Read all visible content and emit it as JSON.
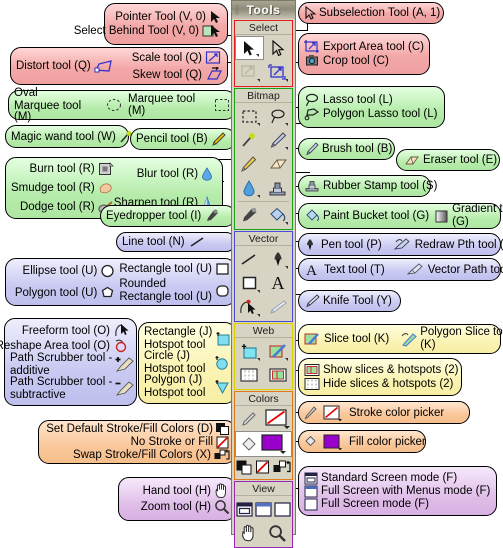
{
  "panel": {
    "title": "Tools",
    "groups": [
      {
        "name": "Select",
        "color": "#e21b1b",
        "tools": [
          "Pointer Tool (V, 0)",
          "Subselection Tool (A, 1)",
          "Export Area tool (C)",
          "Crop tool (C)"
        ]
      },
      {
        "name": "Bitmap",
        "color": "#16a316",
        "tools": [
          "Marquee tool (M)",
          "Lasso tool (L)",
          "Magic wand tool (W)",
          "Brush tool (B)",
          "Pencil tool (B)",
          "Eraser tool (E)",
          "Blur tool (R)",
          "Rubber Stamp tool (S)",
          "Eyedropper tool (I)",
          "Paint Bucket tool (G)"
        ]
      },
      {
        "name": "Vector",
        "color": "#4a4ad6",
        "tools": [
          "Line tool (N)",
          "Pen tool (P)",
          "Rectangle tool (U)",
          "Text tool (T)",
          "Freeform tool (O)",
          "Knife Tool (Y)"
        ]
      },
      {
        "name": "Web",
        "color": "#e0d000",
        "tools": [
          "Rectangle (J) Hotspot tool",
          "Slice tool (K)",
          "Hide slices & hotspots (2)",
          "Show slices & hotspots (2)"
        ]
      },
      {
        "name": "Colors",
        "color": "#e07a1b",
        "tools": [
          "Stroke color picker",
          "Fill color picker",
          "Set Default Stroke/Fill Colors (D)",
          "No Stroke or Fill",
          "Swap Stroke/Fill Colors (X)"
        ]
      },
      {
        "name": "View",
        "color": "#9b26b6",
        "tools": [
          "Standard Screen mode (F)",
          "Full Screen with Menus mode (F)",
          "Full Screen mode (F)",
          "Hand tool (H)",
          "Zoom tool (H)"
        ]
      }
    ]
  },
  "callouts": {
    "pointer": {
      "lines": [
        "Pointer Tool (V, 0)",
        "Select Behind Tool (V, 0)"
      ],
      "color": "pink"
    },
    "subselection": {
      "lines": [
        "Subselection Tool (A, 1)"
      ],
      "color": "pink"
    },
    "distort": {
      "lines": [
        "Distort tool (Q)"
      ],
      "color": "pink"
    },
    "scale_skew": {
      "lines": [
        "Scale tool (Q)",
        "Skew tool (Q)"
      ],
      "color": "pink"
    },
    "export_crop": {
      "lines": [
        "Export Area tool (C)",
        "Crop tool (C)"
      ],
      "color": "pink"
    },
    "marquee": {
      "lines": [
        "Oval\nMarquee tool (M)",
        "Marquee tool (M)"
      ],
      "color": "green",
      "oval": "Oval",
      "oval2": "Marquee tool (M)",
      "rect": "Marquee tool (M)"
    },
    "lasso": {
      "lines": [
        "Lasso tool (L)",
        "Polygon Lasso tool (L)"
      ],
      "color": "green"
    },
    "magicwand": {
      "lines": [
        "Magic wand tool (W)"
      ],
      "color": "green"
    },
    "pencil": {
      "lines": [
        "Pencil tool (B)"
      ],
      "color": "green"
    },
    "brush": {
      "lines": [
        "Brush tool (B)"
      ],
      "color": "green"
    },
    "eraser": {
      "lines": [
        "Eraser tool (E)"
      ],
      "color": "green"
    },
    "retouch": {
      "color": "green",
      "burn": "Burn tool (R)",
      "blur": "Blur tool (R)",
      "smudge": "Smudge tool (R)",
      "sharpen": "Sharpen tool (R)",
      "dodge": "Dodge tool (R)"
    },
    "rubberstamp": {
      "lines": [
        "Rubber Stamp tool (S)"
      ],
      "color": "green"
    },
    "eyedropper": {
      "lines": [
        "Eyedropper tool (I)"
      ],
      "color": "green"
    },
    "paintbucket": {
      "color": "green",
      "bucket": "Paint Bucket tool (G)",
      "gradient": "Gradient tool\n(G)",
      "gradient1": "Gradient tool",
      "gradient2": "(G)"
    },
    "line": {
      "lines": [
        "Line tool (N)"
      ],
      "color": "violet"
    },
    "pen": {
      "color": "violet",
      "pen": "Pen tool (P)",
      "redraw": "Redraw Pth tool (P)",
      "vectorpath": "Vector Path tool (P)"
    },
    "shapes": {
      "color": "violet",
      "ellipse": "Ellipse tool (U)",
      "rectangle": "Rectangle tool (U)",
      "polygon": "Polygon tool (U)",
      "rounded1": "Rounded",
      "rounded2": "Rectangle tool (U)"
    },
    "text": {
      "lines": [
        "Text tool (T)"
      ],
      "color": "violet"
    },
    "knife": {
      "lines": [
        "Knife Tool (Y)"
      ],
      "color": "violet"
    },
    "freeform": {
      "color": "violet",
      "freeform": "Freeform tool (O)",
      "reshape": "Reshape Area tool (O)",
      "scrub_add1": "Path Scrubber tool -",
      "scrub_add2": "additive",
      "scrub_sub1": "Path Scrubber tool -",
      "scrub_sub2": "subtractive"
    },
    "hotspots": {
      "color": "yellow",
      "rect1": "Rectangle (J)",
      "rect2": "Hotspot tool",
      "circ1": "Circle (J)",
      "circ2": "Hotspot tool",
      "poly1": "Polygon (J)",
      "poly2": "Hotspot tool"
    },
    "slice": {
      "color": "yellow",
      "slice": "Slice tool (K)",
      "poly1": "Polygon Slice tool",
      "poly2": "(K)"
    },
    "showhide": {
      "color": "yellow",
      "show": "Show slices & hotspots (2)",
      "hide": "Hide slices & hotspots (2)"
    },
    "stroke": {
      "lines": [
        "Stroke color picker"
      ],
      "color": "orange"
    },
    "fill": {
      "lines": [
        "Fill color picker"
      ],
      "color": "orange"
    },
    "defaults": {
      "color": "orange",
      "setdefault": "Set Default Stroke/Fill Colors (D)",
      "nostroke": "No Stroke or Fill",
      "swap": "Swap Stroke/Fill Colors (X)"
    },
    "screenmodes": {
      "color": "purple",
      "standard": "Standard Screen mode (F)",
      "menus": "Full Screen with Menus mode (F)",
      "full": "Full Screen mode (F)"
    },
    "handzoom": {
      "color": "purple",
      "hand": "Hand tool (H)",
      "zoom": "Zoom tool (H)"
    }
  },
  "colors": {
    "select_border": "#e21b1b",
    "bitmap_border": "#16a316",
    "vector_border": "#4a4ad6",
    "web_border": "#e0d000",
    "colors_border": "#e07a1b",
    "view_border": "#9b26b6",
    "fill_swatch": "#9900cc",
    "panel_bg": "#d8d4c4"
  }
}
